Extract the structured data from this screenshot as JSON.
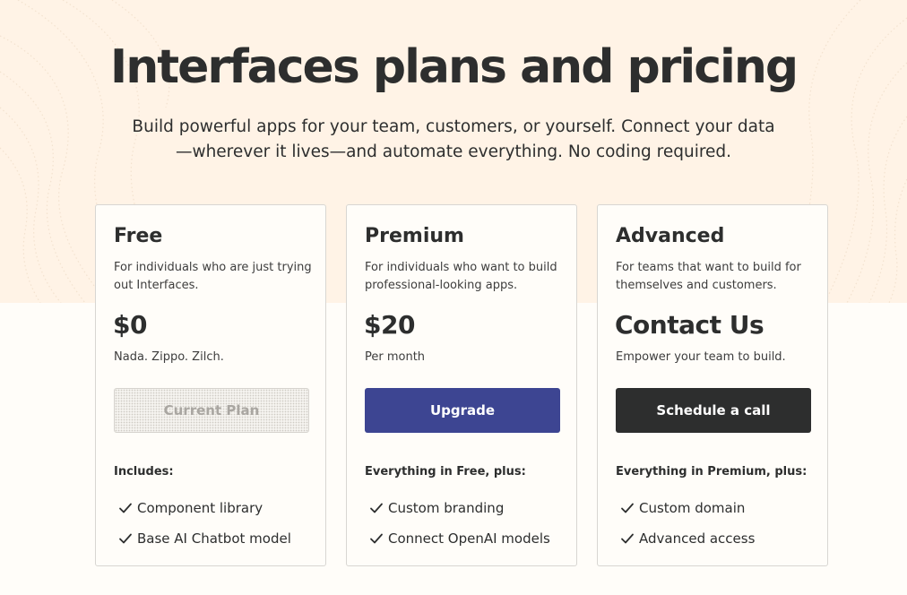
{
  "header": {
    "title": "Interfaces plans and pricing",
    "subtitle": "Build powerful apps for your team, customers, or yourself. Connect your data—wherever it lives—and automate everything. No coding required."
  },
  "colors": {
    "hero_background": "#fff3e6",
    "page_background": "#fffdf9",
    "upgrade_button": "#3d4592",
    "schedule_button": "#2d2e2e",
    "text": "#2d2e2e"
  },
  "plans": [
    {
      "name": "Free",
      "description": "For individuals who are just trying out Interfaces.",
      "price": "$0",
      "price_note": "Nada. Zippo. Zilch.",
      "button_label": "Current Plan",
      "includes_label": "Includes:",
      "features": [
        "Component library",
        "Base AI Chatbot model"
      ]
    },
    {
      "name": "Premium",
      "description": "For individuals who want to build professional-looking apps.",
      "price": "$20",
      "price_note": "Per month",
      "button_label": "Upgrade",
      "includes_label": "Everything in Free, plus:",
      "features": [
        "Custom branding",
        "Connect OpenAI models"
      ]
    },
    {
      "name": "Advanced",
      "description": "For teams that want to build for themselves and customers.",
      "price": "Contact Us",
      "price_note": "Empower your team to build.",
      "button_label": "Schedule a call",
      "includes_label": "Everything in Premium, plus:",
      "features": [
        "Custom domain",
        "Advanced access"
      ]
    }
  ],
  "icons": {
    "feature_bullet": "check-icon"
  }
}
